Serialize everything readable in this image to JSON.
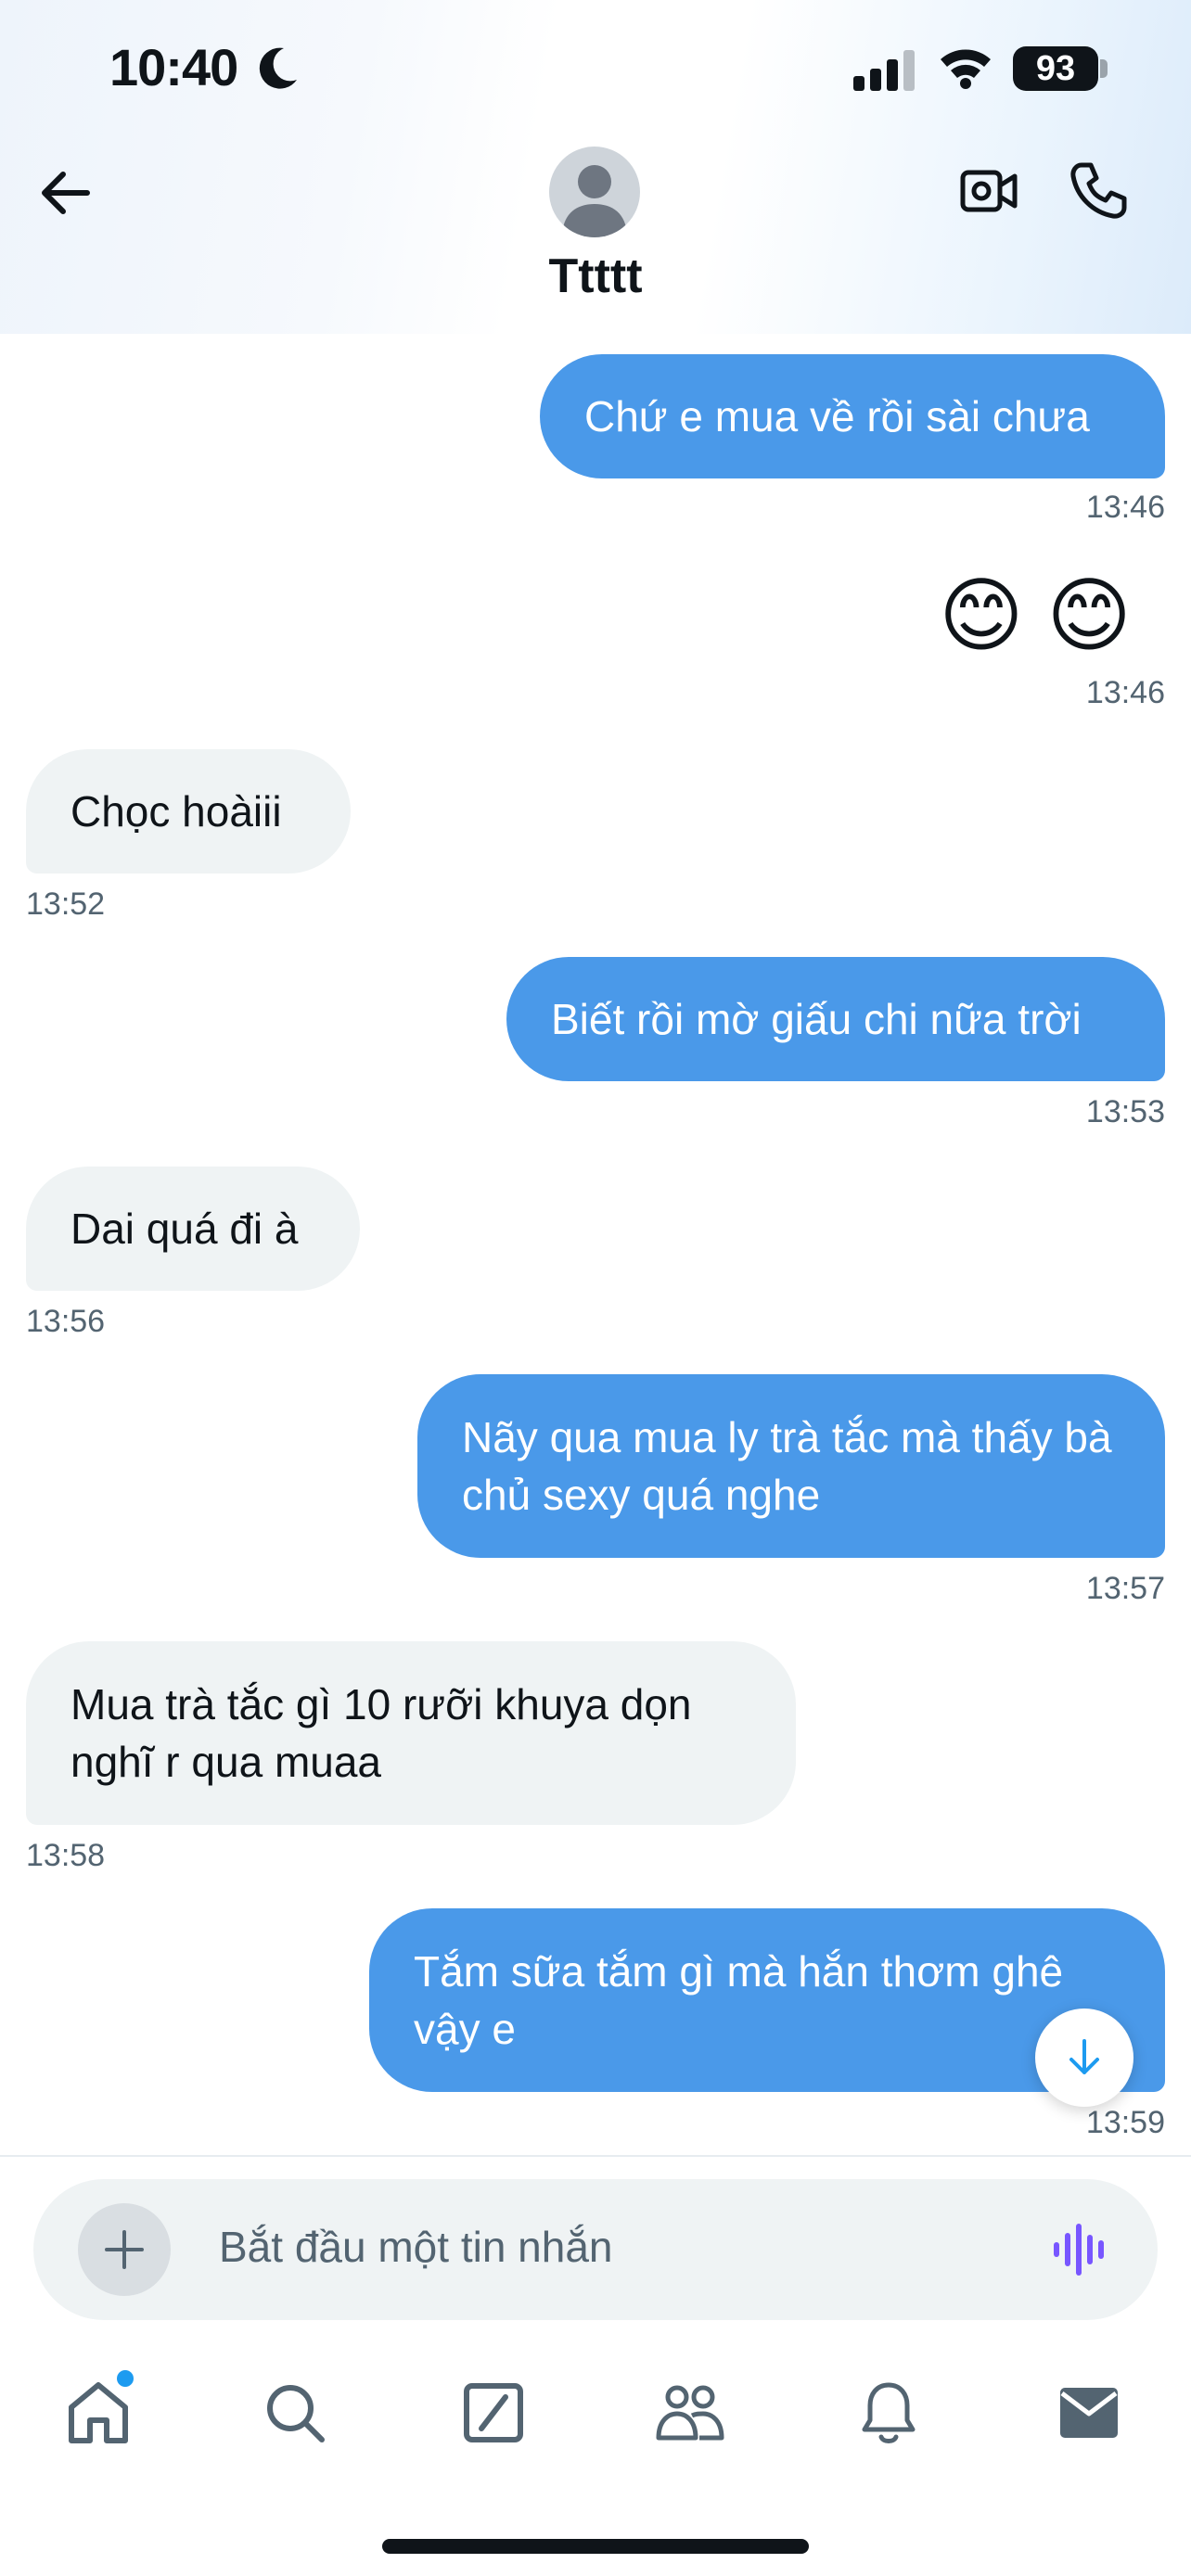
{
  "status_bar": {
    "time": "10:40",
    "battery": "93"
  },
  "header": {
    "contact_name": "Ttttt"
  },
  "messages": [
    {
      "dir": "out",
      "text": "Chứ e mua về rồi sài chưa",
      "time": "13:46"
    },
    {
      "dir": "out",
      "text": "😊 😊",
      "time": "13:46",
      "emoji": true
    },
    {
      "dir": "in",
      "text": "Chọc hoàiii",
      "time": "13:52"
    },
    {
      "dir": "out",
      "text": "Biết rồi mờ giấu chi nữa trời",
      "time": "13:53"
    },
    {
      "dir": "in",
      "text": "Dai quá đi à",
      "time": "13:56"
    },
    {
      "dir": "out",
      "text": "Nãy qua mua ly trà tắc mà thấy bà chủ sexy quá nghe",
      "time": "13:57"
    },
    {
      "dir": "in",
      "text": "Mua trà tắc gì 10 rưỡi khuya dọn nghĩ r qua muaa",
      "time": "13:58"
    },
    {
      "dir": "out",
      "text": "Tắm sữa tắm gì mà hắn thơm ghê vậy e",
      "time": "13:59"
    }
  ],
  "composer": {
    "placeholder": "Bắt đầu một tin nhắn"
  },
  "colors": {
    "outgoing_bubble": "#4a99e9",
    "incoming_bubble": "#eff3f4",
    "accent": "#1d9bf0",
    "voice_icon": "#7856ff"
  },
  "tabs": [
    {
      "icon": "home-icon",
      "has_notification_dot": true
    },
    {
      "icon": "search-icon"
    },
    {
      "icon": "grok-icon"
    },
    {
      "icon": "communities-icon"
    },
    {
      "icon": "notifications-icon"
    },
    {
      "icon": "messages-icon",
      "active": true
    }
  ]
}
